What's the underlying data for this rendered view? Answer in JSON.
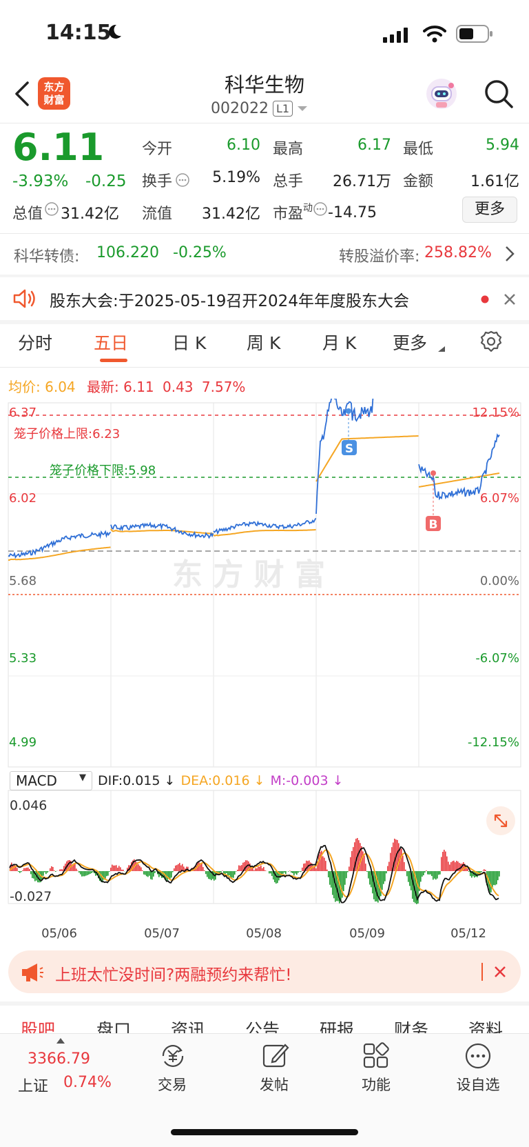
{
  "status": {
    "time": "14:15"
  },
  "header": {
    "logo_line1": "东方",
    "logo_line2": "财富",
    "stock_name": "科华生物",
    "stock_code": "002022",
    "level_badge": "L1"
  },
  "quote": {
    "price": "6.11",
    "change_pct": "-3.93%",
    "change": "-0.25",
    "open_label": "今开",
    "open": "6.10",
    "high_label": "最高",
    "high": "6.17",
    "low_label": "最低",
    "low": "5.94",
    "turnover_label": "换手",
    "turnover": "5.19%",
    "volume_label": "总手",
    "volume": "26.71万",
    "amount_label": "金额",
    "amount": "1.61亿",
    "mcap_label": "总值",
    "mcap": "31.42亿",
    "float_label": "流值",
    "float_cap": "31.42亿",
    "pe_label": "市盈",
    "pe_sup": "动",
    "pe": "-14.75",
    "more_button": "更多"
  },
  "bond": {
    "label": "科华转债:",
    "price": "106.220",
    "change": "-0.25%",
    "premium_label": "转股溢价率:",
    "premium": "258.82%"
  },
  "notice": {
    "text": "股东大会:于2025-05-19召开2024年年度股东大会"
  },
  "chart_tabs": [
    "分时",
    "五日",
    "日 K",
    "周 K",
    "月 K",
    "更多"
  ],
  "legend": {
    "avg_label": "均价:",
    "avg": "6.04",
    "latest_label": "最新:",
    "latest": "6.11",
    "chg": "0.43",
    "pct": "7.57%"
  },
  "chart_data": {
    "type": "line",
    "y_left_ticks": [
      "6.37",
      "6.02",
      "5.68",
      "5.33",
      "4.99"
    ],
    "y_right_ticks": [
      "12.15%",
      "6.07%",
      "0.00%",
      "-6.07%",
      "-12.15%"
    ],
    "ylim": [
      4.99,
      6.37
    ],
    "upper_limit_label": "笼子价格上限:6.23",
    "upper_limit": 6.23,
    "lower_limit_label": "笼子价格下限:5.98",
    "lower_limit": 5.98,
    "x_labels": [
      "05/06",
      "05/07",
      "05/08",
      "05/09",
      "05/12"
    ],
    "series": [
      {
        "name": "最新",
        "color": "#2f6fd6"
      },
      {
        "name": "均价",
        "color": "#f5a623"
      }
    ],
    "markers": [
      {
        "label": "S",
        "color": "#4a90e2"
      },
      {
        "label": "B",
        "color": "#f06a6a"
      }
    ]
  },
  "macd": {
    "name": "MACD",
    "dif": "DIF:0.015 ↓",
    "dea": "DEA:0.016 ↓",
    "m": "M:-0.003 ↓",
    "top": "0.046",
    "bottom": "-0.027"
  },
  "banner": {
    "text": "上班太忙没时间?两融预约来帮忙!"
  },
  "info_tabs": [
    "股吧",
    "盘口",
    "资讯",
    "公告",
    "研报",
    "财务",
    "资料"
  ],
  "bottom_bar": {
    "index_value": "3366.79",
    "index_name": "上证",
    "index_pct": "0.74%",
    "trade": "交易",
    "post": "发帖",
    "function": "功能",
    "watchlist": "设自选"
  },
  "colors": {
    "up": "#e8383d",
    "down": "#1a9a2c",
    "accent": "#f0582e"
  }
}
